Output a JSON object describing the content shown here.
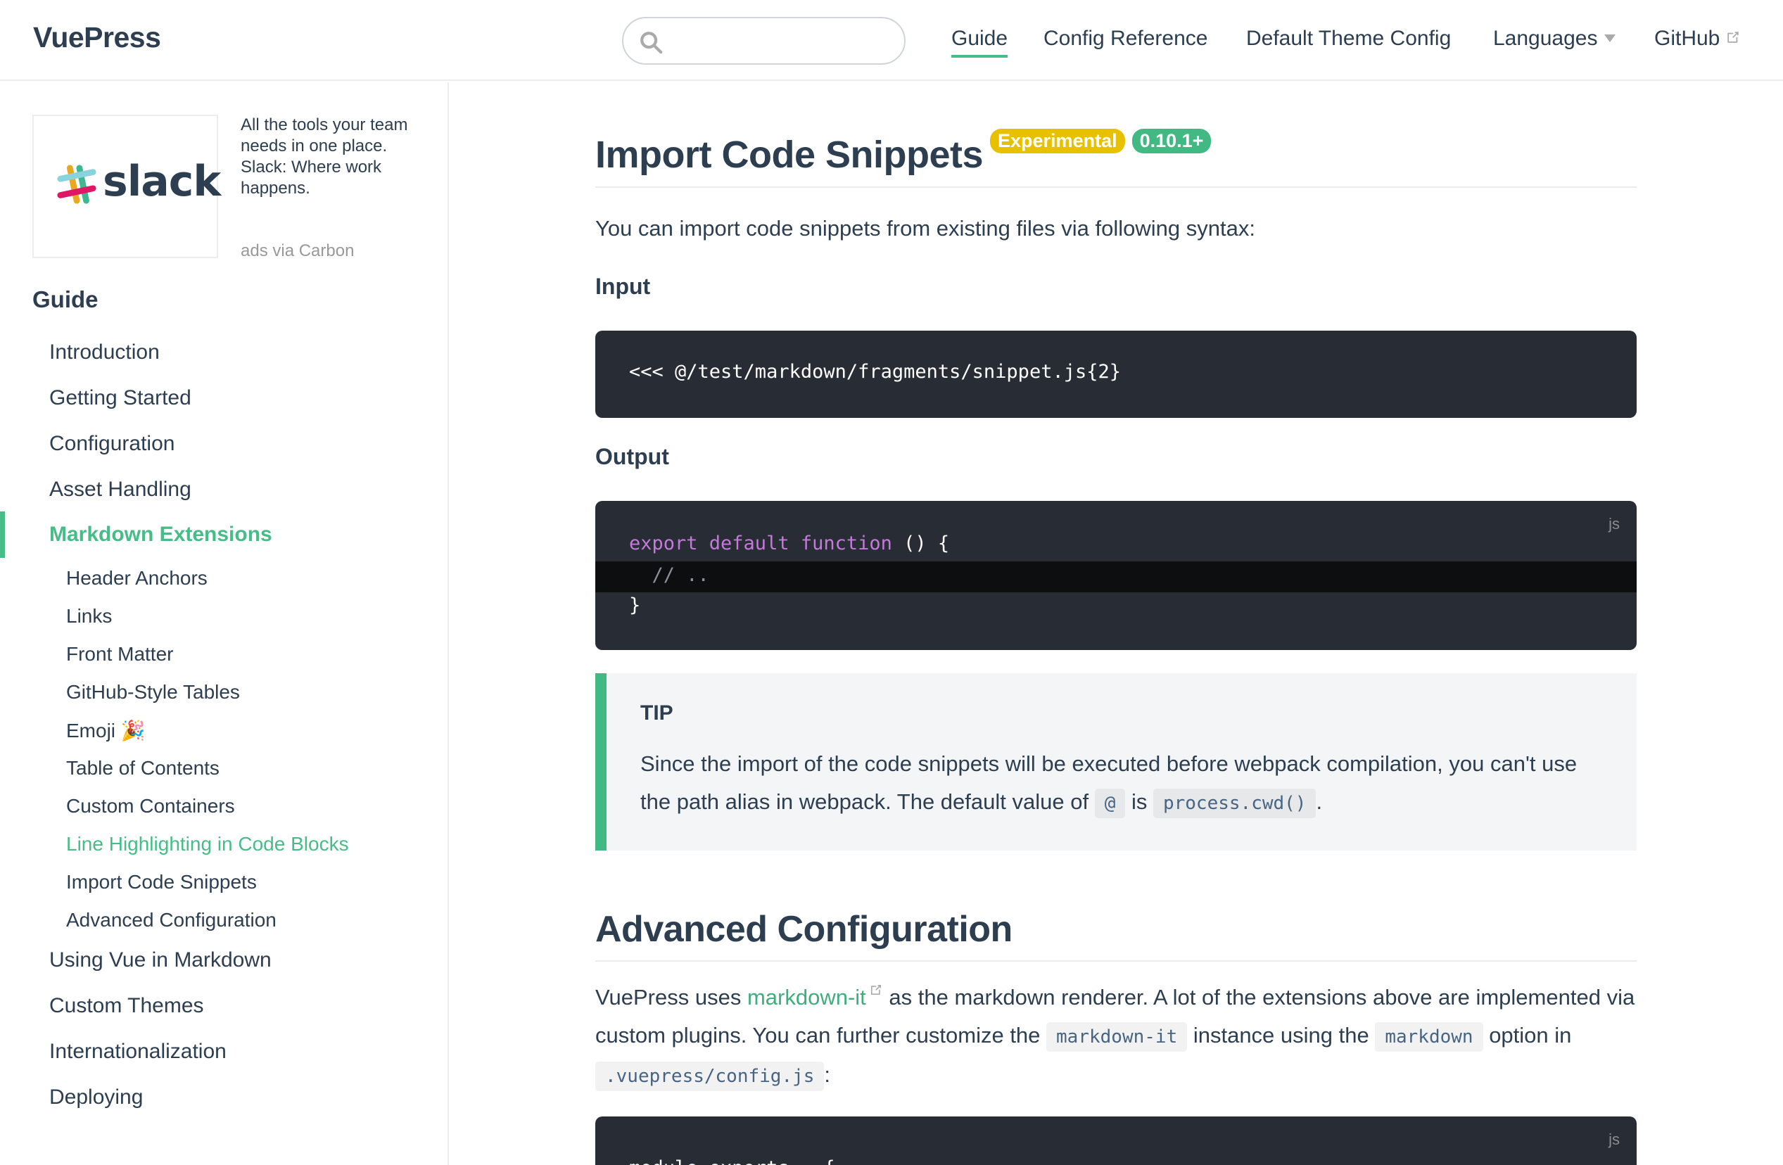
{
  "navbar": {
    "site_name": "VuePress",
    "search": {
      "value": "",
      "placeholder": ""
    },
    "items": [
      {
        "label": "Guide"
      },
      {
        "label": "Config Reference"
      },
      {
        "label": "Default Theme Config"
      },
      {
        "label": "Languages"
      },
      {
        "label": "GitHub"
      }
    ]
  },
  "sidebar": {
    "ad": {
      "brand": "slack",
      "text": "All the tools your team needs in one place. Slack: Where work happens.",
      "powered_by": "ads via Carbon"
    },
    "heading": "Guide",
    "links": [
      {
        "label": "Introduction"
      },
      {
        "label": "Getting Started"
      },
      {
        "label": "Configuration"
      },
      {
        "label": "Asset Handling"
      },
      {
        "label": "Markdown Extensions"
      },
      {
        "label": "Using Vue in Markdown"
      },
      {
        "label": "Custom Themes"
      },
      {
        "label": "Internationalization"
      },
      {
        "label": "Deploying"
      }
    ],
    "sub_links": [
      {
        "label": "Header Anchors"
      },
      {
        "label": "Links"
      },
      {
        "label": "Front Matter"
      },
      {
        "label": "GitHub-Style Tables"
      },
      {
        "label": "Emoji 🎉"
      },
      {
        "label": "Table of Contents"
      },
      {
        "label": "Custom Containers"
      },
      {
        "label": "Line Highlighting in Code Blocks"
      },
      {
        "label": "Import Code Snippets"
      },
      {
        "label": "Advanced Configuration"
      }
    ]
  },
  "content": {
    "title": "Import Code Snippets",
    "badges": [
      "Experimental",
      "0.10.1+"
    ],
    "intro": "You can import code snippets from existing files via following syntax:",
    "input_heading": "Input",
    "input_code": "<<< @/test/markdown/fragments/snippet.js{2}",
    "output_heading": "Output",
    "output_lang": "js",
    "output_code": {
      "line1_kw": "export default function",
      "line1_rest": " () {",
      "line2": "  // ..",
      "line3": "}"
    },
    "tip": {
      "title": "TIP",
      "text_before": "Since the import of the code snippets will be executed before webpack compilation, you can't use the path alias in webpack. The default value of ",
      "code1": "@",
      "text_mid": " is ",
      "code2": "process.cwd()",
      "text_after": "."
    },
    "advanced": {
      "title": "Advanced Configuration",
      "p_before": "VuePress uses ",
      "link": "markdown-it",
      "p_mid": " as the markdown renderer. A lot of the extensions above are implemented via custom plugins. You can further customize the ",
      "code1": "markdown-it",
      "p_mid2": " instance using the ",
      "code2": "markdown",
      "p_mid3": " option in ",
      "code3": ".vuepress/config.js",
      "p_after": ":",
      "code_lang": "js",
      "code_line1_a": "module.exports ",
      "code_line1_op": "=",
      "code_line1_b": " {"
    }
  },
  "colors": {
    "accent": "#3eaf7c",
    "text": "#2c3e50",
    "badge_warning": "#e7c000",
    "badge_tip": "#42b983",
    "code_bg": "#282c34"
  }
}
